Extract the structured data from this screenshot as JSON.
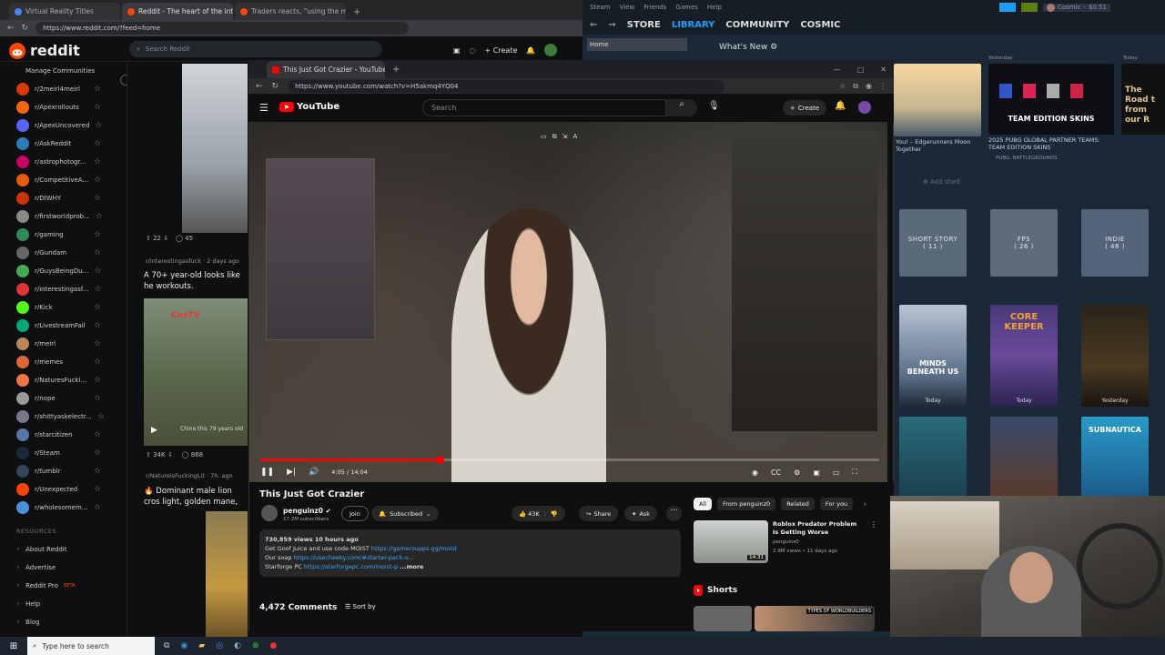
{
  "left_browser": {
    "tabs": [
      {
        "label": "Virtual Reality Titles",
        "color": "#4285f4"
      },
      {
        "label": "Reddit - The heart of the internet",
        "color": "#ff4500"
      },
      {
        "label": "Traders reacts, \"using the moveme...",
        "color": "#ff4500"
      }
    ],
    "url": "https://www.reddit.com/?feed=home",
    "reddit": {
      "logo_text": "reddit",
      "search_placeholder": "Search Reddit",
      "create_label": "Create",
      "manage": "Manage Communities",
      "communities": [
        "r/2meirl4meirl",
        "r/Apexrollouts",
        "r/ApexUncovered",
        "r/AskReddit",
        "r/astrophotogr...",
        "r/CompetitiveA...",
        "r/DIWHY",
        "r/firstworldprob...",
        "r/gaming",
        "r/Gundam",
        "r/GuysBeingDu...",
        "r/interestingasf...",
        "r/Kick",
        "r/LivestreamFail",
        "r/meirl",
        "r/memes",
        "r/NaturesFucki...",
        "r/nope",
        "r/shittyaskelectr...",
        "r/starcitizen",
        "r/Steam",
        "r/tumblr",
        "r/Unexpected",
        "r/wholesomem..."
      ],
      "resources_heading": "RESOURCES",
      "resources": [
        "About Reddit",
        "Advertise",
        "Reddit Pro",
        "Help",
        "Blog"
      ],
      "reddit_pro_badge": "BETA",
      "post1": {
        "upvotes": "22",
        "comments": "45"
      },
      "post2": {
        "sub": "r/interestingasfuck",
        "age": "2 days ago",
        "title": "A 70+ year-old looks like he workouts.",
        "overlay_brand": "CnsTV",
        "caption": "China this 79 years old",
        "upvotes": "34K",
        "comments": "868"
      },
      "post3": {
        "sub": "r/NaturelsFuckingLit",
        "age": "7h. ago",
        "title": "🔥 Dominant male lion cros light, golden mane, golden"
      }
    }
  },
  "steam": {
    "menu": [
      "Steam",
      "View",
      "Friends",
      "Games",
      "Help"
    ],
    "nav": [
      "STORE",
      "LIBRARY",
      "COMMUNITY",
      "COSMIC"
    ],
    "user": "Cosmic",
    "wallet": "$0.51",
    "home": "Home",
    "whats_new": "What's New",
    "cards": [
      {
        "label": "Yesterday"
      },
      {
        "title": "2025 PUBG GLOBAL PARTNER TEAMS: TEAM EDITION SKINS",
        "publisher": "PUBG: BATTLEGROUNDS",
        "banner": "TEAM EDITION SKINS"
      },
      {
        "label": "Today",
        "title": "The Road t from our R"
      }
    ],
    "card_left_caption": "You! – Edgerunners Moon Together",
    "add_shelf": "Add shelf",
    "collections": [
      {
        "name": "SHORT STORY",
        "count": "( 11 )"
      },
      {
        "name": "FPS",
        "count": "( 26 )"
      },
      {
        "name": "INDIE",
        "count": "( 48 )"
      }
    ],
    "games": [
      {
        "title": "MINDS BENEATH US",
        "tag": "Today"
      },
      {
        "title": "CORE KEEPER",
        "tag": "Today"
      },
      {
        "title": "",
        "tag": "Yesterday"
      }
    ],
    "row3": [
      "",
      "",
      "SUBNAUTICA"
    ]
  },
  "youtube": {
    "tab_title": "This Just Got Crazier - YouTube",
    "url": "https://www.youtube.com/watch?v=H5akmq4YQ04",
    "logo": "YouTube",
    "search_placeholder": "Search",
    "create_label": "Create",
    "video": {
      "time": "4:05 / 14:04",
      "progress": 0.29
    },
    "title": "This Just Got Crazier",
    "channel": "penguinz0",
    "subscribers": "17.2M subscribers",
    "join": "Join",
    "subscribed": "Subscribed",
    "likes": "43K",
    "share": "Share",
    "ask": "Ask",
    "desc_meta": "730,859 views  10 hours ago",
    "desc_lines": [
      {
        "text": "Get Goof Juice and use code MOIST",
        "link": "https://gamersupps.gg/moist"
      },
      {
        "text": "Our soap",
        "link": "https://usecheeky.com/#starter-pack-o..."
      },
      {
        "text": "Starforge PC",
        "link": "https://starforgepc.com/moist-p"
      }
    ],
    "more": "...more",
    "comments_count": "4,472 Comments",
    "sort_by": "Sort by",
    "chips": [
      "All",
      "From penguinz0",
      "Related",
      "For you"
    ],
    "rec": {
      "title": "Roblox Predator Problem Is Getting Worse",
      "channel": "penguinz0",
      "meta": "2.9M views • 11 days ago",
      "duration": "14:31"
    },
    "shorts": "Shorts",
    "short_caption": "TYPES OF WORLDBUILDERS"
  },
  "taskbar": {
    "search_placeholder": "Type here to search"
  }
}
